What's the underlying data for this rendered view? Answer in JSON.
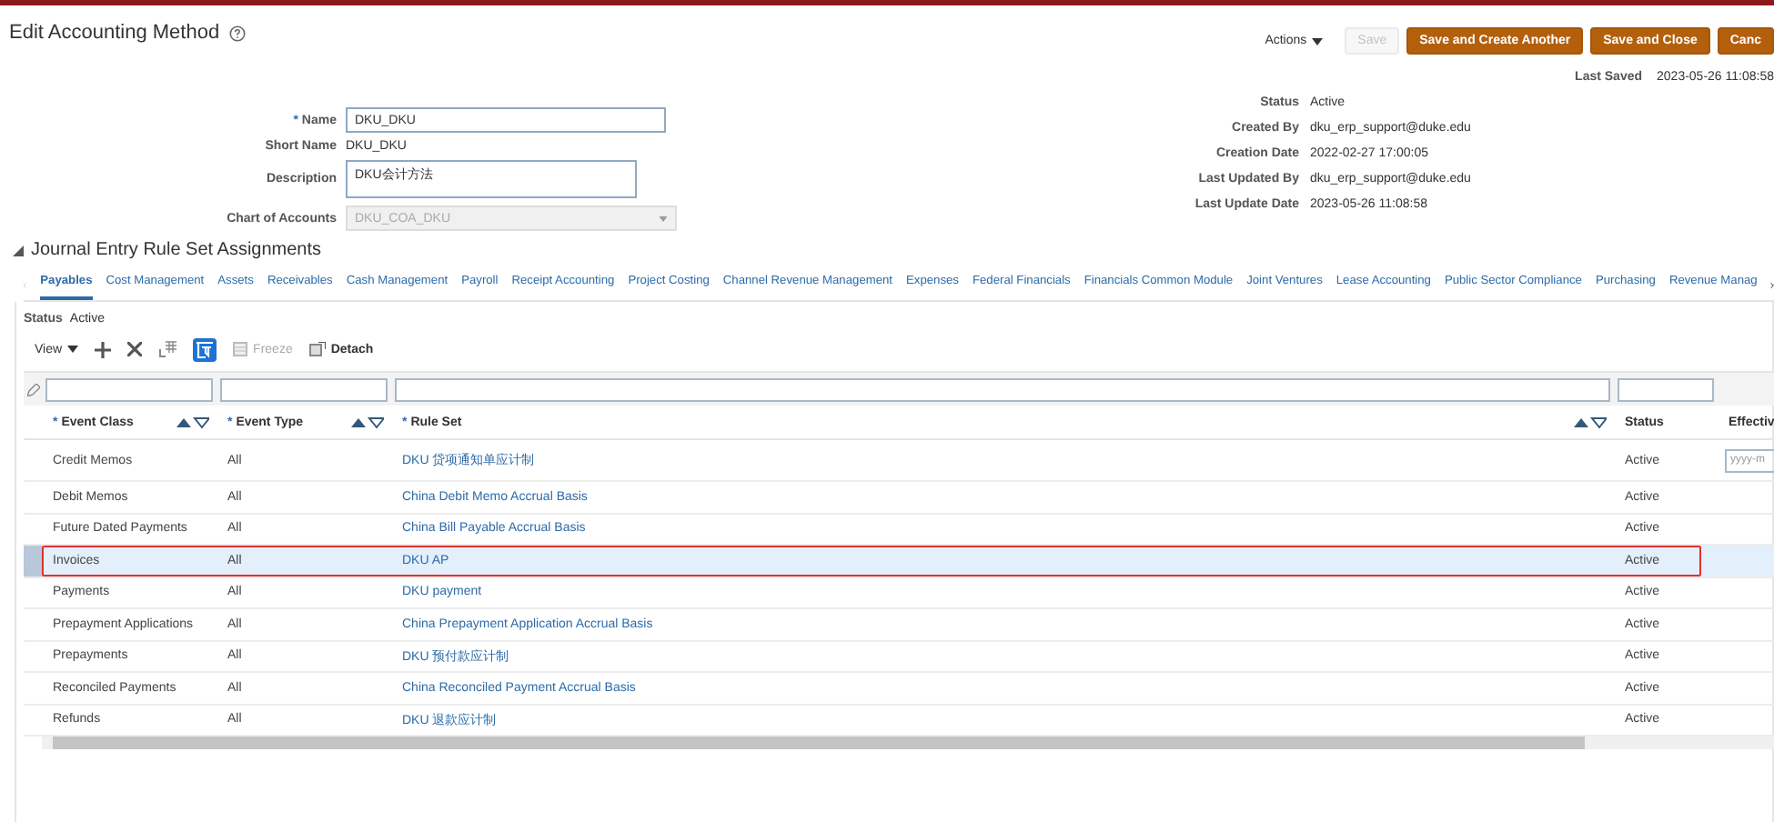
{
  "page": {
    "title": "Edit Accounting Method"
  },
  "required_mark": "*",
  "header_actions": {
    "actions_menu": "Actions",
    "buttons": [
      {
        "label": "Save",
        "kind": "plain",
        "disabled": true
      },
      {
        "label": "Save and Create Another",
        "kind": "primary",
        "disabled": false
      },
      {
        "label": "Save and Close",
        "kind": "primary",
        "disabled": false
      },
      {
        "label": "Canc",
        "kind": "primary",
        "disabled": false
      }
    ]
  },
  "last_saved": {
    "label": "Last Saved",
    "value": "2023-05-26 11:08:58"
  },
  "form": [
    {
      "label": "Name",
      "required": true,
      "kind": "input",
      "value": "DKU_DKU"
    },
    {
      "label": "Short Name",
      "required": false,
      "kind": "text",
      "value": "DKU_DKU"
    },
    {
      "label": "Description",
      "required": false,
      "kind": "textarea",
      "value": "DKU会计方法"
    },
    {
      "label": "Chart of Accounts",
      "required": false,
      "kind": "select",
      "value": "DKU_COA_DKU",
      "disabled": true
    }
  ],
  "details": [
    {
      "label": "Status",
      "value": "Active"
    },
    {
      "label": "Created By",
      "value": "dku_erp_support@duke.edu"
    },
    {
      "label": "Creation Date",
      "value": "2022-02-27 17:00:05"
    },
    {
      "label": "Last Updated By",
      "value": "dku_erp_support@duke.edu"
    },
    {
      "label": "Last Update Date",
      "value": "2023-05-26 11:08:58"
    }
  ],
  "section": {
    "title": "Journal Entry Rule Set Assignments",
    "expanded": true
  },
  "tabs": [
    {
      "label": "Payables",
      "selected": true
    },
    {
      "label": "Cost Management",
      "selected": false
    },
    {
      "label": "Assets",
      "selected": false
    },
    {
      "label": "Receivables",
      "selected": false
    },
    {
      "label": "Cash Management",
      "selected": false
    },
    {
      "label": "Payroll",
      "selected": false
    },
    {
      "label": "Receipt Accounting",
      "selected": false
    },
    {
      "label": "Project Costing",
      "selected": false
    },
    {
      "label": "Channel Revenue Management",
      "selected": false
    },
    {
      "label": "Expenses",
      "selected": false
    },
    {
      "label": "Federal Financials",
      "selected": false
    },
    {
      "label": "Financials Common Module",
      "selected": false
    },
    {
      "label": "Joint Ventures",
      "selected": false
    },
    {
      "label": "Lease Accounting",
      "selected": false
    },
    {
      "label": "Public Sector Compliance",
      "selected": false
    },
    {
      "label": "Purchasing",
      "selected": false
    },
    {
      "label": "Revenue Manag",
      "selected": false
    }
  ],
  "status": {
    "label": "Status",
    "value": "Active"
  },
  "toolbar": {
    "view": "View",
    "freeze": {
      "label": "Freeze",
      "disabled": true
    },
    "detach": {
      "label": "Detach",
      "disabled": false
    }
  },
  "table": {
    "columns": [
      {
        "label": "Event Class",
        "required": true,
        "sortable": true
      },
      {
        "label": "Event Type",
        "required": true,
        "sortable": true
      },
      {
        "label": "Rule Set",
        "required": true,
        "sortable": true
      },
      {
        "label": "Status",
        "required": false,
        "sortable": false
      },
      {
        "label": "Effectiv",
        "required": false,
        "sortable": false
      }
    ],
    "date_placeholder": "yyyy-m",
    "rows": [
      {
        "event_class": "Credit Memos",
        "event_type": "All",
        "rule_set": "DKU 贷项通知单应计制",
        "status": "Active",
        "selected": false,
        "highlighted": false
      },
      {
        "event_class": "Debit Memos",
        "event_type": "All",
        "rule_set": "China Debit Memo Accrual Basis",
        "status": "Active",
        "selected": false,
        "highlighted": false
      },
      {
        "event_class": "Future Dated Payments",
        "event_type": "All",
        "rule_set": "China Bill Payable Accrual Basis",
        "status": "Active",
        "selected": false,
        "highlighted": false
      },
      {
        "event_class": "Invoices",
        "event_type": "All",
        "rule_set": "DKU AP",
        "status": "Active",
        "selected": true,
        "highlighted": true
      },
      {
        "event_class": "Payments",
        "event_type": "All",
        "rule_set": "DKU payment",
        "status": "Active",
        "selected": false,
        "highlighted": false
      },
      {
        "event_class": "Prepayment Applications",
        "event_type": "All",
        "rule_set": "China Prepayment Application Accrual Basis",
        "status": "Active",
        "selected": false,
        "highlighted": false
      },
      {
        "event_class": "Prepayments",
        "event_type": "All",
        "rule_set": "DKU 预付款应计制",
        "status": "Active",
        "selected": false,
        "highlighted": false
      },
      {
        "event_class": "Reconciled Payments",
        "event_type": "All",
        "rule_set": "China Reconciled Payment Accrual Basis",
        "status": "Active",
        "selected": false,
        "highlighted": false
      },
      {
        "event_class": "Refunds",
        "event_type": "All",
        "rule_set": "DKU 退款应计制",
        "status": "Active",
        "selected": false,
        "highlighted": false
      }
    ]
  }
}
